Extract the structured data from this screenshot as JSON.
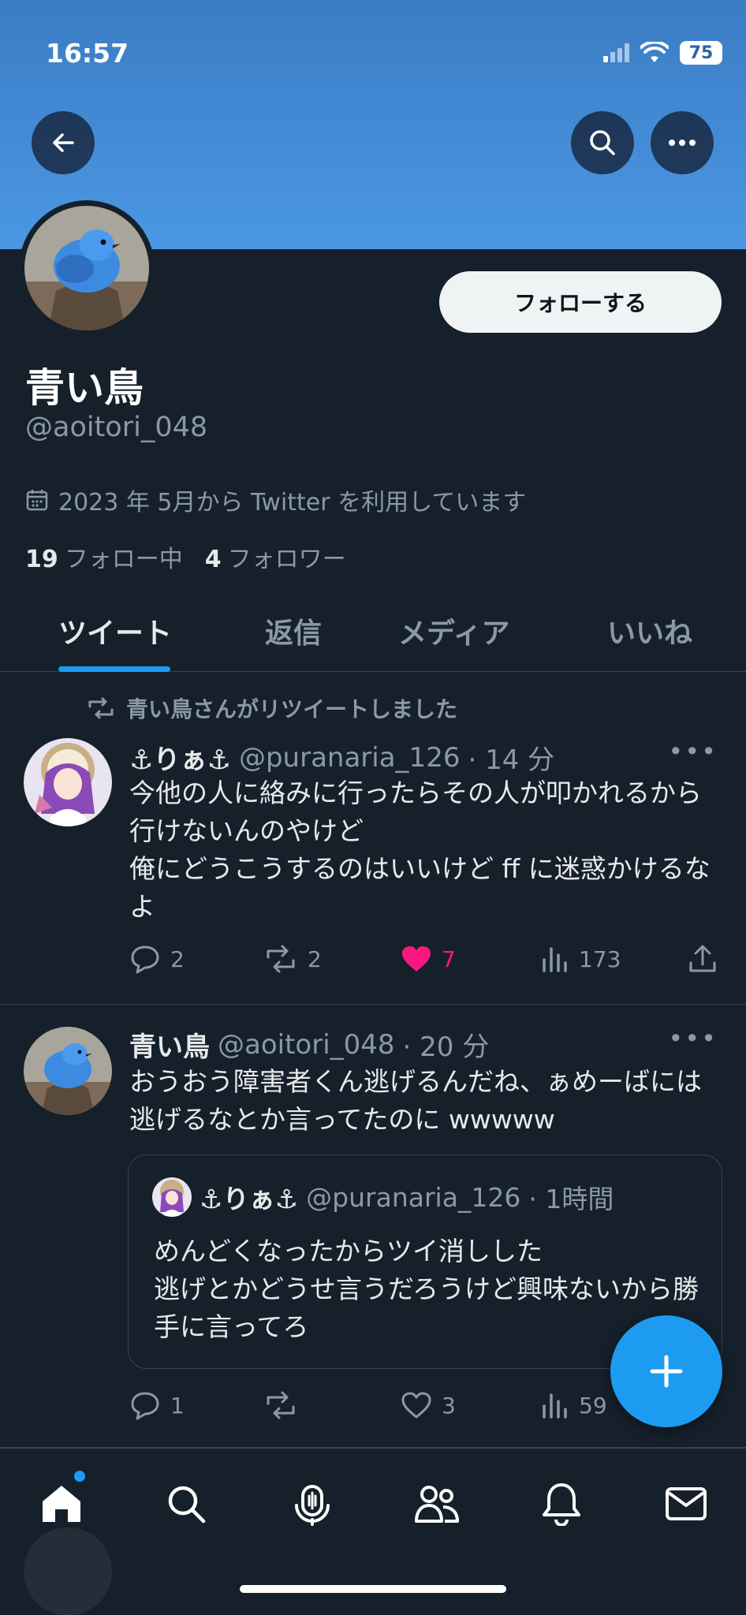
{
  "status_bar": {
    "time": "16:57",
    "battery": "75"
  },
  "profile": {
    "name": "青い鳥",
    "handle": "@aoitori_048",
    "joined": "2023 年 5月から Twitter を利用しています",
    "following_count": "19",
    "following_label": "フォロー中",
    "followers_count": "4",
    "followers_label": "フォロワー",
    "follow_button": "フォローする"
  },
  "tabs": [
    {
      "label": "ツイート",
      "active": true
    },
    {
      "label": "返信"
    },
    {
      "label": "メディア"
    },
    {
      "label": "いいね"
    }
  ],
  "tweets": [
    {
      "retweet_label": "青い鳥さんがリツイートしました",
      "display_name": "⚓りぁ⚓",
      "handle": "@puranaria_126",
      "time": "· 14 分",
      "text": "今他の人に絡みに行ったらその人が叩かれるから行けないんのやけど\n俺にどうこうするのはいいけど ff に迷惑かけるなよ",
      "replies": "2",
      "retweets": "2",
      "likes": "7",
      "views": "173"
    },
    {
      "display_name": "青い鳥",
      "handle": "@aoitori_048",
      "time": "· 20 分",
      "text": "おうおう障害者くん逃げるんだね、ぁめーばには逃げるなとか言ってたのに wwwww",
      "quote": {
        "display_name": "⚓りぁ⚓",
        "handle": "@puranaria_126",
        "time": "· 1時間",
        "text": "めんどくなったからツイ消しした\n逃げとかどうせ言うだろうけど興味ないから勝手に言ってろ"
      },
      "replies": "1",
      "likes": "3",
      "views": "59"
    }
  ],
  "colors": {
    "accent": "#1d9bf0",
    "like": "#f91880",
    "background": "#15202b"
  }
}
